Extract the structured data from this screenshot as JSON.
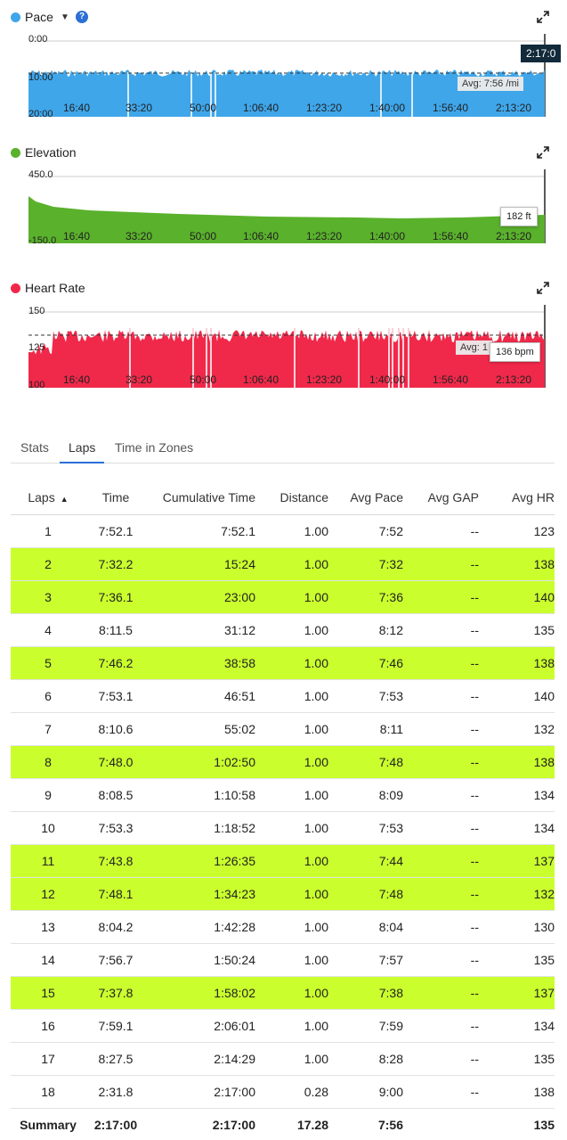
{
  "charts": [
    {
      "id": "pace",
      "title": "Pace",
      "color": "#3fa6ea",
      "y_top_label": "0:00",
      "y_mid_label": "10:00",
      "y_bottom_label": "20:00",
      "avg_label": "Avg: 7:56 /mi",
      "time_badge": "2:17:0",
      "x_ticks": [
        "16:40",
        "33:20",
        "50:00",
        "1:06:40",
        "1:23:20",
        "1:40:00",
        "1:56:40",
        "2:13:20"
      ]
    },
    {
      "id": "elevation",
      "title": "Elevation",
      "color": "#5ab12c",
      "y_top_label": "450.0",
      "y_bottom_label": "-150.0",
      "tooltip": "182 ft",
      "x_ticks": [
        "16:40",
        "33:20",
        "50:00",
        "1:06:40",
        "1:23:20",
        "1:40:00",
        "1:56:40",
        "2:13:20"
      ]
    },
    {
      "id": "heartrate",
      "title": "Heart Rate",
      "color": "#f0294a",
      "y_top_label": "150",
      "y_mid_label": "125",
      "y_bottom_label": "100",
      "avg_label": "Avg: 1",
      "tooltip": "136 bpm",
      "x_ticks": [
        "16:40",
        "33:20",
        "50:00",
        "1:06:40",
        "1:23:20",
        "1:40:00",
        "1:56:40",
        "2:13:20"
      ]
    }
  ],
  "tabs": [
    {
      "label": "Stats",
      "active": false
    },
    {
      "label": "Laps",
      "active": true
    },
    {
      "label": "Time in Zones",
      "active": false
    }
  ],
  "table": {
    "headers": [
      "Laps",
      "Time",
      "Cumulative Time",
      "Distance",
      "Avg Pace",
      "Avg GAP",
      "Avg HR"
    ],
    "rows": [
      {
        "lap": "1",
        "time": "7:52.1",
        "cum": "7:52.1",
        "dist": "1.00",
        "pace": "7:52",
        "gap": "--",
        "hr": "123",
        "hl": false
      },
      {
        "lap": "2",
        "time": "7:32.2",
        "cum": "15:24",
        "dist": "1.00",
        "pace": "7:32",
        "gap": "--",
        "hr": "138",
        "hl": true
      },
      {
        "lap": "3",
        "time": "7:36.1",
        "cum": "23:00",
        "dist": "1.00",
        "pace": "7:36",
        "gap": "--",
        "hr": "140",
        "hl": true
      },
      {
        "lap": "4",
        "time": "8:11.5",
        "cum": "31:12",
        "dist": "1.00",
        "pace": "8:12",
        "gap": "--",
        "hr": "135",
        "hl": false
      },
      {
        "lap": "5",
        "time": "7:46.2",
        "cum": "38:58",
        "dist": "1.00",
        "pace": "7:46",
        "gap": "--",
        "hr": "138",
        "hl": true
      },
      {
        "lap": "6",
        "time": "7:53.1",
        "cum": "46:51",
        "dist": "1.00",
        "pace": "7:53",
        "gap": "--",
        "hr": "140",
        "hl": false
      },
      {
        "lap": "7",
        "time": "8:10.6",
        "cum": "55:02",
        "dist": "1.00",
        "pace": "8:11",
        "gap": "--",
        "hr": "132",
        "hl": false
      },
      {
        "lap": "8",
        "time": "7:48.0",
        "cum": "1:02:50",
        "dist": "1.00",
        "pace": "7:48",
        "gap": "--",
        "hr": "138",
        "hl": true
      },
      {
        "lap": "9",
        "time": "8:08.5",
        "cum": "1:10:58",
        "dist": "1.00",
        "pace": "8:09",
        "gap": "--",
        "hr": "134",
        "hl": false
      },
      {
        "lap": "10",
        "time": "7:53.3",
        "cum": "1:18:52",
        "dist": "1.00",
        "pace": "7:53",
        "gap": "--",
        "hr": "134",
        "hl": false
      },
      {
        "lap": "11",
        "time": "7:43.8",
        "cum": "1:26:35",
        "dist": "1.00",
        "pace": "7:44",
        "gap": "--",
        "hr": "137",
        "hl": true
      },
      {
        "lap": "12",
        "time": "7:48.1",
        "cum": "1:34:23",
        "dist": "1.00",
        "pace": "7:48",
        "gap": "--",
        "hr": "132",
        "hl": true
      },
      {
        "lap": "13",
        "time": "8:04.2",
        "cum": "1:42:28",
        "dist": "1.00",
        "pace": "8:04",
        "gap": "--",
        "hr": "130",
        "hl": false
      },
      {
        "lap": "14",
        "time": "7:56.7",
        "cum": "1:50:24",
        "dist": "1.00",
        "pace": "7:57",
        "gap": "--",
        "hr": "135",
        "hl": false
      },
      {
        "lap": "15",
        "time": "7:37.8",
        "cum": "1:58:02",
        "dist": "1.00",
        "pace": "7:38",
        "gap": "--",
        "hr": "137",
        "hl": true
      },
      {
        "lap": "16",
        "time": "7:59.1",
        "cum": "2:06:01",
        "dist": "1.00",
        "pace": "7:59",
        "gap": "--",
        "hr": "134",
        "hl": false
      },
      {
        "lap": "17",
        "time": "8:27.5",
        "cum": "2:14:29",
        "dist": "1.00",
        "pace": "8:28",
        "gap": "--",
        "hr": "135",
        "hl": false
      },
      {
        "lap": "18",
        "time": "2:31.8",
        "cum": "2:17:00",
        "dist": "0.28",
        "pace": "9:00",
        "gap": "--",
        "hr": "138",
        "hl": false
      }
    ],
    "summary": {
      "label": "Summary",
      "time": "2:17:00",
      "cum": "2:17:00",
      "dist": "17.28",
      "pace": "7:56",
      "gap": "",
      "hr": "135"
    }
  }
}
